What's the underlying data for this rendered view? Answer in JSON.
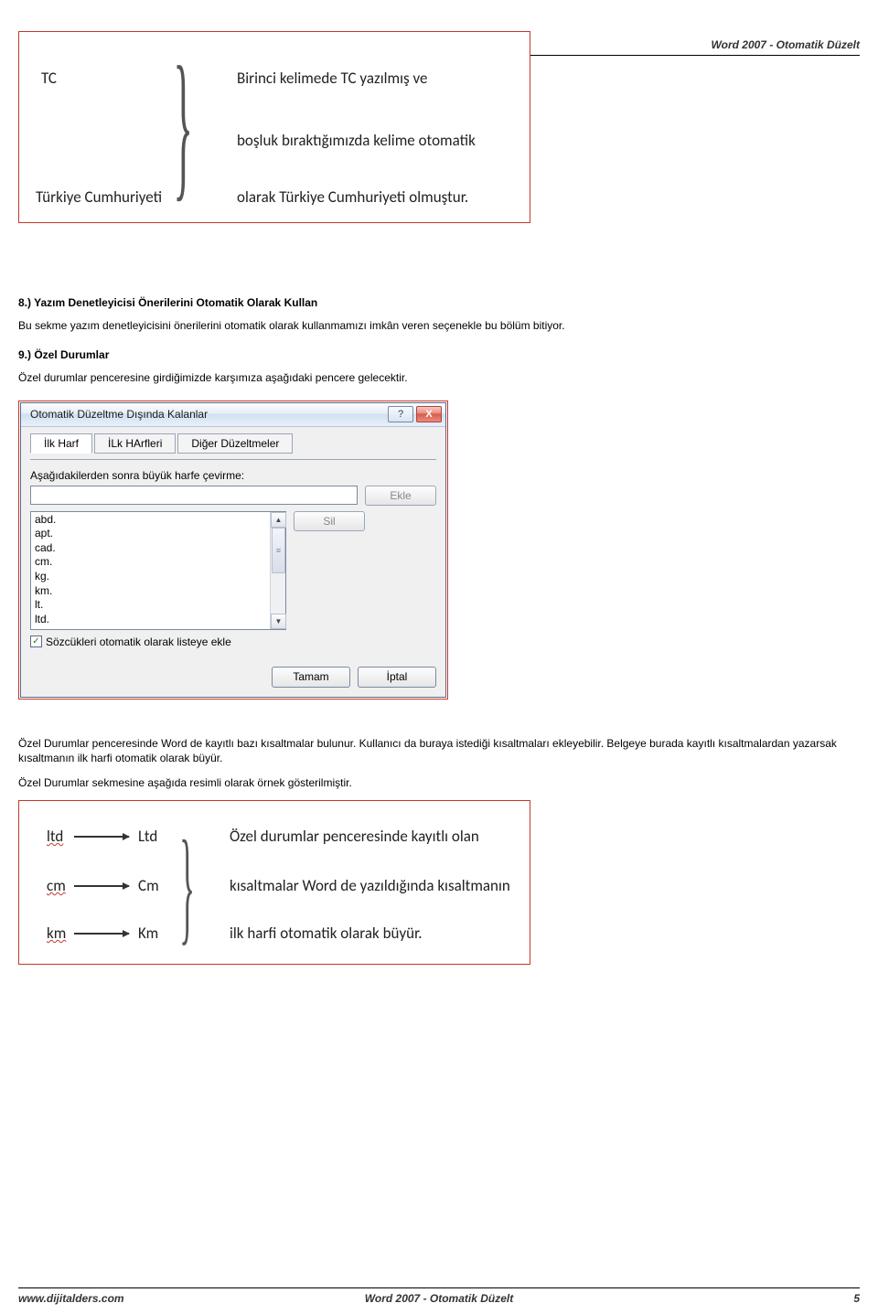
{
  "header": {
    "title": "Word 2007 - Otomatik Düzelt"
  },
  "figure1": {
    "left_top": "TC",
    "left_bottom": "Türkiye Cumhuriyeti",
    "right_line1": "Birinci kelimede TC yazılmış ve",
    "right_line2": "boşluk bıraktığımızda kelime otomatik",
    "right_line3": "olarak Türkiye Cumhuriyeti olmuştur."
  },
  "section8": {
    "title": "8.) Yazım Denetleyicisi Önerilerini Otomatik Olarak Kullan",
    "body": "Bu sekme yazım denetleyicisini önerilerini otomatik olarak kullanmamızı imkân veren seçenekle bu bölüm bitiyor."
  },
  "section9": {
    "title": "9.) Özel Durumlar",
    "body": "Özel durumlar penceresine girdiğimizde karşımıza aşağıdaki pencere gelecektir."
  },
  "dialog": {
    "title": "Otomatik Düzeltme Dışında Kalanlar",
    "tabs": {
      "t1": "İlk Harf",
      "t2": "İLk HArfleri",
      "t3": "Diğer Düzeltmeler"
    },
    "label": "Aşağıdakilerden sonra büyük harfe çevirme:",
    "add": "Ekle",
    "del": "Sil",
    "list": [
      "abd.",
      "apt.",
      "cad.",
      "cm.",
      "kg.",
      "km.",
      "lt.",
      "ltd."
    ],
    "checkbox": "Sözcükleri otomatik olarak listeye ekle",
    "ok": "Tamam",
    "cancel": "İptal"
  },
  "afterDialog": {
    "p1": "Özel Durumlar penceresinde Word de kayıtlı bazı kısaltmalar bulunur. Kullanıcı da buraya istediği kısaltmaları ekleyebilir. Belgeye burada kayıtlı kısaltmalardan yazarsak kısaltmanın ilk harfi otomatik olarak büyür.",
    "p2": "Özel Durumlar sekmesine aşağıda resimli olarak örnek gösterilmiştir."
  },
  "figure2": {
    "rows": [
      {
        "a": "ltd",
        "b": "Ltd",
        "desc": "Özel durumlar penceresinde kayıtlı olan"
      },
      {
        "a": "cm",
        "b": "Cm",
        "desc": "kısaltmalar Word de yazıldığında kısaltmanın"
      },
      {
        "a": "km",
        "b": "Km",
        "desc": "ilk harfi otomatik olarak büyür."
      }
    ]
  },
  "footer": {
    "left": "www.dijitalders.com",
    "center": "Word 2007 - Otomatik Düzelt",
    "right": "5"
  }
}
